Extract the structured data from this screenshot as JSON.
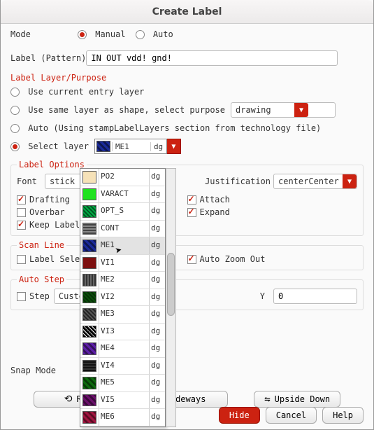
{
  "title": "Create Label",
  "mode": {
    "label": "Mode",
    "options": {
      "manual": "Manual",
      "auto": "Auto"
    },
    "selected": "manual"
  },
  "labelPattern": {
    "label": "Label (Pattern)",
    "value": "IN OUT vdd! gnd!"
  },
  "layerSection": {
    "title": "Label Layer/Purpose",
    "opt_current": "Use current entry layer",
    "opt_sameprefix": "Use same layer as shape, select purpose",
    "opt_auto": "Auto (Using stampLabelLayers section from technology file)",
    "opt_select": "Select layer",
    "selected": "select",
    "purpose_value": "drawing",
    "current_layer": {
      "name": "ME1",
      "purpose": "dg",
      "swatchClass": "sw-me1"
    }
  },
  "labelOptions": {
    "title": "Label Options",
    "font_label": "Font",
    "font_value": "stick",
    "justification_label": "Justification",
    "justification_value": "centerCenter",
    "drafting_label": "Drafting",
    "drafting_checked": true,
    "overbar_label": "Overbar",
    "overbar_checked": false,
    "keeplabel_label": "Keep Label",
    "keeplabel_checked": true,
    "attach_label": "Attach",
    "attach_checked": true,
    "expand_label": "Expand",
    "expand_checked": true
  },
  "scanLine": {
    "title": "Scan Line",
    "labelselected_label": "Label Selected",
    "labelselected_checked": false,
    "autozoom_label": "Auto Zoom Out",
    "autozoom_checked": true
  },
  "autoStep": {
    "title": "Auto Step",
    "step_label": "Step",
    "step_checked": false,
    "step_mode": "Custom",
    "y_label": "Y",
    "y_value": "0"
  },
  "snap": {
    "label": "Snap Mode"
  },
  "rotateButtons": {
    "rotate": "Rotate",
    "sideways": "Sideways",
    "upsidedown": "Upside Down"
  },
  "bottom": {
    "hide": "Hide",
    "cancel": "Cancel",
    "help": "Help"
  },
  "layerList": [
    {
      "name": "PO2",
      "purpose": "dg",
      "swatchClass": "sw-po2"
    },
    {
      "name": "VARACT",
      "purpose": "dg",
      "swatchClass": "sw-varact"
    },
    {
      "name": "OPT_S",
      "purpose": "dg",
      "swatchClass": "sw-opts"
    },
    {
      "name": "CONT",
      "purpose": "dg",
      "swatchClass": "sw-cont"
    },
    {
      "name": "ME1",
      "purpose": "dg",
      "swatchClass": "sw-me1",
      "selected": true
    },
    {
      "name": "VI1",
      "purpose": "dg",
      "swatchClass": "sw-vi1"
    },
    {
      "name": "ME2",
      "purpose": "dg",
      "swatchClass": "sw-me2"
    },
    {
      "name": "VI2",
      "purpose": "dg",
      "swatchClass": "sw-vi2"
    },
    {
      "name": "ME3",
      "purpose": "dg",
      "swatchClass": "sw-me3"
    },
    {
      "name": "VI3",
      "purpose": "dg",
      "swatchClass": "sw-vi3"
    },
    {
      "name": "ME4",
      "purpose": "dg",
      "swatchClass": "sw-me4"
    },
    {
      "name": "VI4",
      "purpose": "dg",
      "swatchClass": "sw-vi4"
    },
    {
      "name": "ME5",
      "purpose": "dg",
      "swatchClass": "sw-me5"
    },
    {
      "name": "VI5",
      "purpose": "dg",
      "swatchClass": "sw-vi5"
    },
    {
      "name": "ME6",
      "purpose": "dg",
      "swatchClass": "sw-me6"
    }
  ]
}
